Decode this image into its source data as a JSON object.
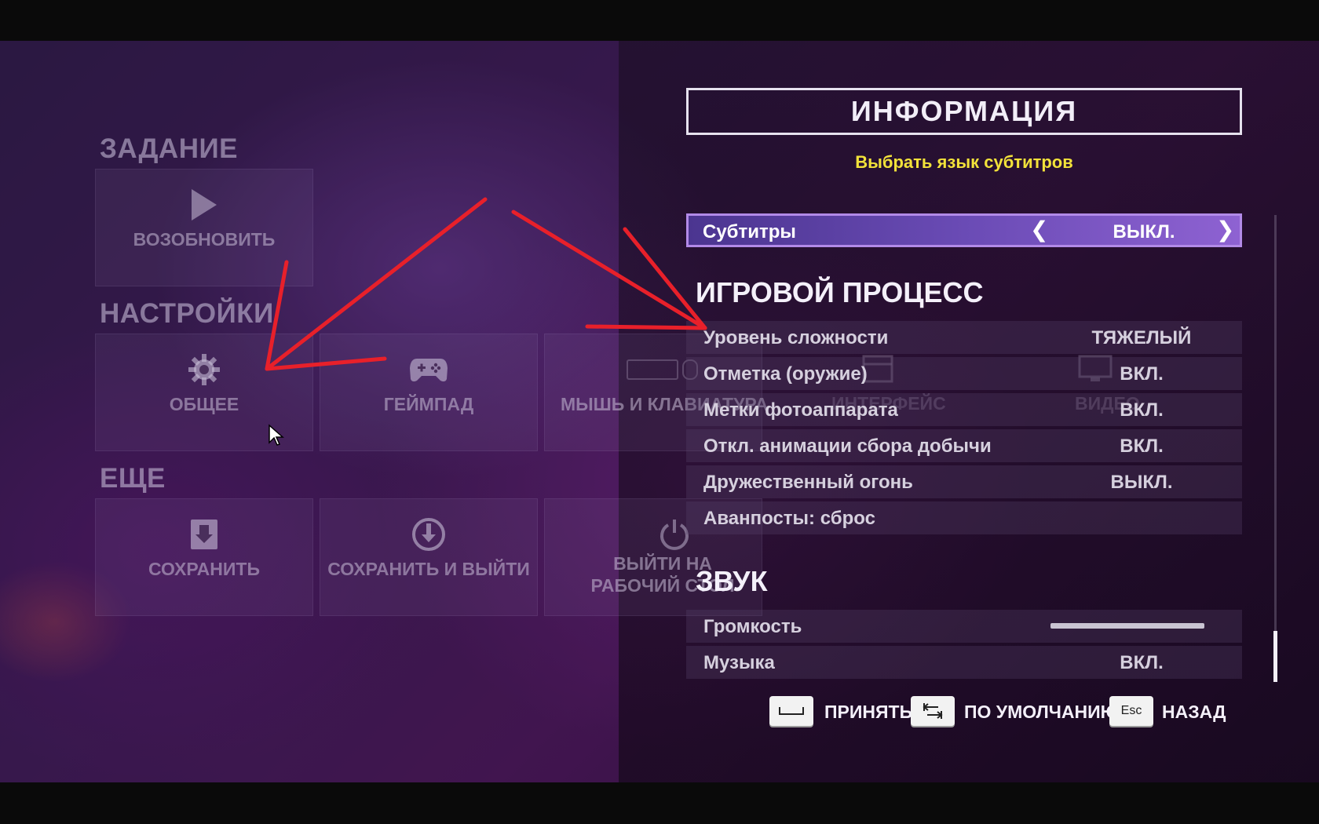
{
  "left_menu": {
    "sections": [
      {
        "title": "ЗАДАНИЕ",
        "tiles": [
          {
            "label": "ВОЗОБНОВИТЬ",
            "icon": "play-icon"
          }
        ]
      },
      {
        "title": "НАСТРОЙКИ",
        "tiles": [
          {
            "label": "ОБЩЕЕ",
            "icon": "gear-icon"
          },
          {
            "label": "ГЕЙМПАД",
            "icon": "gamepad-icon"
          },
          {
            "label": "МЫШЬ И КЛАВИАТУРА",
            "icon": "keyboard-icon"
          },
          {
            "label": "ИНТЕРФЕЙС",
            "icon": "interface-icon"
          },
          {
            "label": "ВИДЕО",
            "icon": "monitor-icon"
          }
        ]
      },
      {
        "title": "ЕЩЕ",
        "tiles": [
          {
            "label": "СОХРАНИТЬ",
            "icon": "save-icon"
          },
          {
            "label": "СОХРАНИТЬ И ВЫЙТИ",
            "icon": "save-exit-icon"
          },
          {
            "label": "ВЫЙТИ НА РАБОЧИЙ СТОЛ",
            "icon": "power-icon"
          }
        ]
      }
    ]
  },
  "info": {
    "title": "ИНФОРМАЦИЯ",
    "hint": "Выбрать язык субтитров"
  },
  "subtitles": {
    "label": "Субтитры",
    "value": "ВЫКЛ."
  },
  "gameplay": {
    "title": "ИГРОВОЙ ПРОЦЕСС",
    "rows": [
      {
        "label": "Уровень сложности",
        "value": "ТЯЖЕЛЫЙ"
      },
      {
        "label": "Отметка (оружие)",
        "value": "ВКЛ."
      },
      {
        "label": "Метки фотоаппарата",
        "value": "ВКЛ."
      },
      {
        "label": "Откл. анимации сбора добычи",
        "value": "ВКЛ."
      },
      {
        "label": "Дружественный огонь",
        "value": "ВЫКЛ."
      },
      {
        "label": "Аванпосты: сброс",
        "value": ""
      }
    ]
  },
  "sound": {
    "title": "ЗВУК",
    "rows": [
      {
        "label": "Громкость",
        "value": ""
      },
      {
        "label": "Музыка",
        "value": "ВКЛ."
      }
    ],
    "volume_level": 1.0
  },
  "footer": {
    "accept_label": "ПРИНЯТЬ",
    "default_label": "ПО УМОЛЧАНИЮ",
    "back_key": "Esc",
    "back_label": "НАЗАД"
  },
  "colors": {
    "hint": "#f2e23a",
    "highlight_row": "#6a4bb5",
    "annotation_arrows": "#e8202a"
  }
}
